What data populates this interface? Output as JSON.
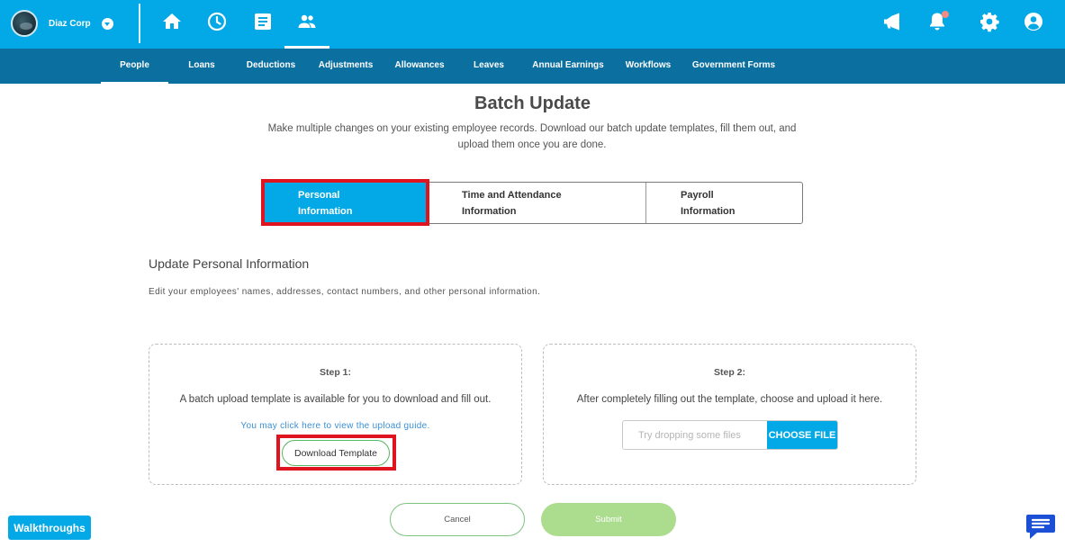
{
  "colors": {
    "primary": "#03a9e6",
    "subnav": "#0b6fa0",
    "highlight": "#e0141e",
    "success": "#58b760",
    "notification_dot": "#f28b82"
  },
  "header": {
    "company_name": "Diaz Corp",
    "icons": [
      "home-icon",
      "clock-icon",
      "document-icon",
      "people-icon",
      "megaphone-icon",
      "bell-icon",
      "gear-icon",
      "user-icon"
    ]
  },
  "subnav": {
    "items": [
      {
        "label": "People",
        "active": true
      },
      {
        "label": "Loans"
      },
      {
        "label": "Deductions"
      },
      {
        "label": "Adjustments"
      },
      {
        "label": "Allowances"
      },
      {
        "label": "Leaves"
      },
      {
        "label": "Annual Earnings"
      },
      {
        "label": "Workflows"
      },
      {
        "label": "Government Forms"
      }
    ]
  },
  "page": {
    "title": "Batch Update",
    "description": "Make multiple changes on your existing employee records. Download our batch update templates, fill them out, and upload them once you are done."
  },
  "tabs": [
    {
      "line1": "Personal",
      "line2": "Information",
      "active": true
    },
    {
      "line1": "Time and Attendance",
      "line2": "Information"
    },
    {
      "line1": "Payroll",
      "line2": "Information"
    }
  ],
  "section": {
    "title": "Update Personal Information",
    "description": "Edit your employees' names, addresses, contact numbers, and other personal information."
  },
  "step1": {
    "label": "Step 1:",
    "text": "A batch upload template is available for you to download and fill out.",
    "link": "You may click here to view the upload guide.",
    "button": "Download Template"
  },
  "step2": {
    "label": "Step 2:",
    "text": "After completely filling out the template, choose and upload it here.",
    "placeholder": "Try dropping some files",
    "button": "CHOOSE FILE"
  },
  "actions": {
    "cancel": "Cancel",
    "submit": "Submit"
  },
  "walkthroughs": "Walkthroughs"
}
